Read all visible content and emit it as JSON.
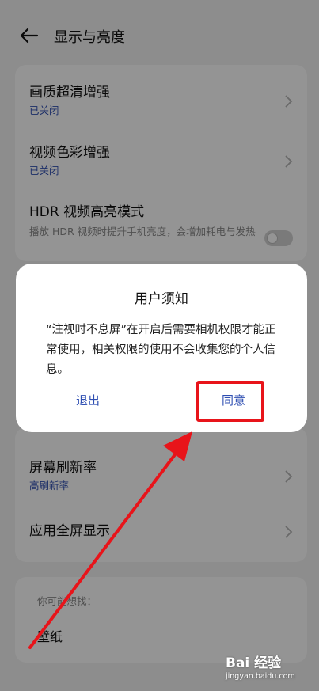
{
  "header": {
    "title": "显示与亮度",
    "back_icon": "arrow-left-icon"
  },
  "settings": {
    "items": [
      {
        "title": "画质超清增强",
        "status": "已关闭"
      },
      {
        "title": "视频色彩增强",
        "status": "已关闭"
      },
      {
        "title": "HDR 视频高亮模式",
        "desc": "播放 HDR 视频时提升手机亮度，会增加耗电与发热",
        "toggle_on": false
      },
      {
        "title": "屏幕刷新率",
        "status": "高刷新率"
      },
      {
        "title": "应用全屏显示"
      }
    ]
  },
  "suggestions": {
    "label": "你可能想找：",
    "items": [
      "壁纸"
    ]
  },
  "dialog": {
    "title": "用户须知",
    "body": "“注视时不息屏”在开启后需要相机权限才能正常使用，相关权限的使用不会收集您的个人信息。",
    "cancel_label": "退出",
    "confirm_label": "同意"
  },
  "watermark": {
    "brand": "Bai 经验",
    "url": "jingyan.baidu.com"
  },
  "colors": {
    "accent": "#2f4fb2",
    "annotation": "#e8141a",
    "card": "#ffffff",
    "background": "#f3f3f3"
  }
}
